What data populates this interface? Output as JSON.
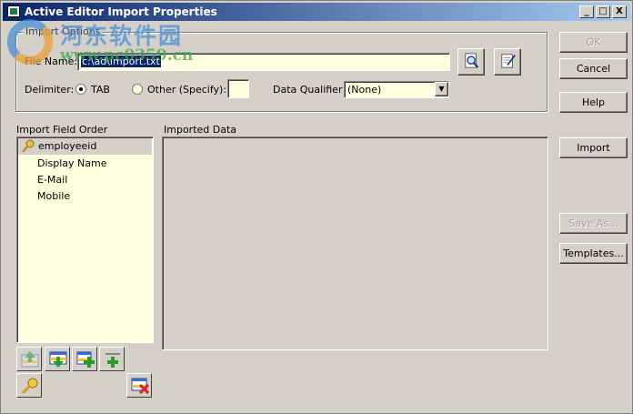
{
  "window": {
    "title": "Active Editor Import Properties",
    "min": "_",
    "max": "□",
    "close": "X"
  },
  "import_options": {
    "group_label": "Import Options",
    "file_name_label": "File Name:",
    "file_name_value": "c:\\ad\\import.txt",
    "delimiter_label": "Delimiter:",
    "tab_label": "TAB",
    "tab_selected": true,
    "other_label": "Other (Specify):",
    "other_value": "",
    "qualifier_label": "Data Qualifier",
    "qualifier_value": "(None)"
  },
  "field_order": {
    "label": "Import Field Order",
    "items": [
      "employeeid",
      "Display Name",
      "E-Mail",
      "Mobile"
    ]
  },
  "imported_data": {
    "label": "Imported Data"
  },
  "buttons": {
    "ok": "OK",
    "cancel": "Cancel",
    "help": "Help",
    "import": "Import",
    "save_as": "Save As...",
    "templates": "Templates..."
  },
  "watermark": {
    "text": "河东软件园",
    "url": "www.pc0359.cn"
  }
}
